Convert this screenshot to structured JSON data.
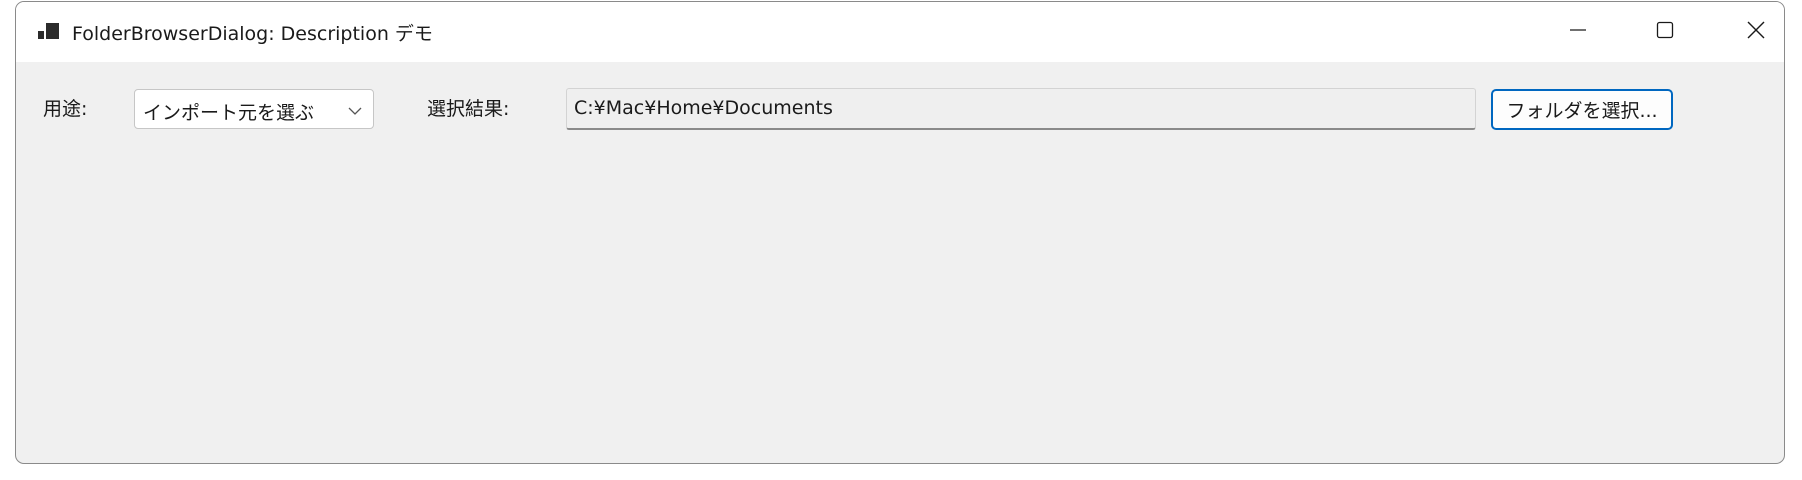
{
  "window": {
    "title": "FolderBrowserDialog: Description デモ",
    "icons": {
      "app": "app-window-icon",
      "minimize": "minimize-icon",
      "maximize": "maximize-icon",
      "close": "close-icon"
    }
  },
  "form": {
    "purpose_label": "用途:",
    "purpose_selected": "インポート元を選ぶ",
    "result_label": "選択結果:",
    "result_value": "C:¥Mac¥Home¥Documents",
    "select_button_label": "フォルダを選択..."
  },
  "colors": {
    "window_bg": "#f0f0f0",
    "titlebar_bg": "#ffffff",
    "accent_border": "#0067c0"
  }
}
